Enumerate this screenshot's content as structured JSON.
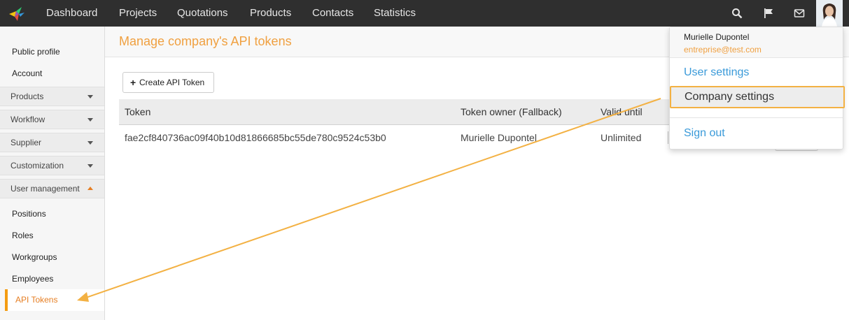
{
  "topbar": {
    "nav": [
      "Dashboard",
      "Projects",
      "Quotations",
      "Products",
      "Contacts",
      "Statistics"
    ],
    "icons": [
      "search-icon",
      "flag-icon",
      "mail-icon"
    ]
  },
  "sidebar": {
    "links_top": [
      "Public profile",
      "Account"
    ],
    "sections": [
      "Products",
      "Workflow",
      "Supplier",
      "Customization",
      "User management"
    ],
    "sub_items": [
      "Positions",
      "Roles",
      "Workgroups",
      "Employees"
    ],
    "active_item": "API Tokens"
  },
  "main": {
    "title": "Manage company's API tokens",
    "create_button": "Create API Token",
    "table": {
      "headers": [
        "Token",
        "Token owner (Fallback)",
        "Valid until"
      ],
      "rows": [
        [
          "fae2cf840736ac09f40b10d81866685bc55de780c9524c53b0",
          "Murielle Dupontel",
          "Unlimited"
        ]
      ]
    }
  },
  "dropdown": {
    "user_name": "Murielle Dupontel",
    "user_email": "entreprise@test.com",
    "items": [
      "User settings",
      "Company settings",
      "Sign out"
    ]
  },
  "colors": {
    "topbar": "#2f2f2f",
    "accent_orange": "#f0a040",
    "link_blue": "#3a9ad9",
    "highlight_border": "#f3b143"
  }
}
